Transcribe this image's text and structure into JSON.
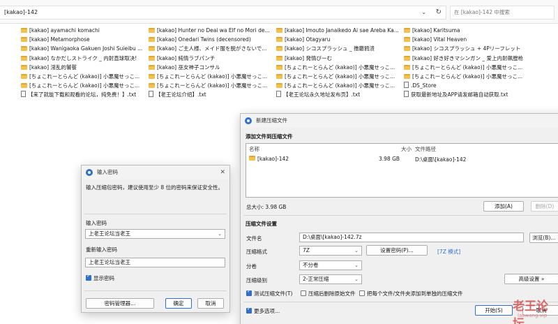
{
  "explorer": {
    "path": "[kakao]-142",
    "search_placeholder": "在 [kakao]-142 中搜索",
    "files": [
      {
        "name": "[kakao] ayamachi komachi",
        "type": "folder"
      },
      {
        "name": "[kakao] Metamorphose",
        "type": "folder"
      },
      {
        "name": "[kakao] Wanigaoka Gakuen Joshi Suieibu ...",
        "type": "folder"
      },
      {
        "name": "[kakao] なかだしストライク _ 内射直球取决!",
        "type": "folder"
      },
      {
        "name": "[kakao] 淫乱的饕餮",
        "type": "folder"
      },
      {
        "name": "[ちょこれーとらんど (kakao)] 小悪魔せっこ...",
        "type": "folder"
      },
      {
        "name": "[ちょこれーとらんど (kakao)] 小悪魔せっこ...",
        "type": "folder"
      },
      {
        "name": "【来了就能下载和观看的论坛，纯免费！】.txt",
        "type": "txt"
      },
      {
        "name": "[kakao] Hunter no Deai wa Elf no Mori de...",
        "type": "folder"
      },
      {
        "name": "[kakao] Onedari Twins (decensored)",
        "type": "folder"
      },
      {
        "name": "[kakao] ご主人様、メイド服を脱がさないで...",
        "type": "folder"
      },
      {
        "name": "[kakao] 純情ラブパンチ",
        "type": "folder"
      },
      {
        "name": "[kakao] 巫女神子コンサル",
        "type": "folder"
      },
      {
        "name": "[ちょこれーとらんど (kakao)] 小悪魔せっこ...",
        "type": "folder"
      },
      {
        "name": "[ちょこれーとらんど (kakao)] 小悪魔せっこ...",
        "type": "folder"
      },
      {
        "name": "【老王论坛介绍】.txt",
        "type": "txt"
      },
      {
        "name": "[kakao] Imouto Janaikedo Ai sae Areba Ka...",
        "type": "folder"
      },
      {
        "name": "[kakao] Otagyaru",
        "type": "folder"
      },
      {
        "name": "[kakao] シコスプラッシュ _ 撸蘑鸦溃",
        "type": "folder"
      },
      {
        "name": "[kakao] 発情びーむ",
        "type": "folder"
      },
      {
        "name": "[ちょこれーとらんど (kakao)] 小悪魔せっこ...",
        "type": "folder"
      },
      {
        "name": "[ちょこれーとらんど (kakao)] 小悪魔せっこ...",
        "type": "folder"
      },
      {
        "name": "[ちょこれーとらんど (kakao)] 小悪魔せっこ...",
        "type": "folder"
      },
      {
        "name": "【老王论坛永久地址发布页】.txt",
        "type": "txt"
      },
      {
        "name": "[kakao] Karitsuma",
        "type": "folder"
      },
      {
        "name": "[kakao] Vital Heaven",
        "type": "folder"
      },
      {
        "name": "[kakao] シコスプラッシュ + 4Pリーフレット",
        "type": "folder"
      },
      {
        "name": "[kakao] 好き好きマシンガン _ 爱上内射飙膛枪",
        "type": "folder"
      },
      {
        "name": "[ちょこれーとらんど (kakao)] 小悪魔せっこ...",
        "type": "folder"
      },
      {
        "name": "[ちょこれーとらんど (kakao)] 小悪魔せっこ...",
        "type": "folder"
      },
      {
        "name": ".DS_Store",
        "type": "txt"
      },
      {
        "name": "获取最新地址及APP请发邮箱自动获取.txt",
        "type": "txt"
      }
    ]
  },
  "password_dialog": {
    "title": "输入密码",
    "description": "输入压缩包密码，建议使用至少 8 位的密码来保证安全性。",
    "enter_label": "输入密码",
    "enter_value": "上老王论坛当老王",
    "reenter_label": "重新输入密码",
    "reenter_value": "上老王论坛当老王",
    "show_password_label": "显示密码",
    "manager_button": "密码管理器...",
    "ok_button": "确定",
    "cancel_button": "取消"
  },
  "archive_dialog": {
    "title": "新建压缩文件",
    "add_section": "添加文件到压缩文件",
    "list_headers": {
      "name": "名称",
      "size": "大小",
      "path": "文件路径"
    },
    "list_row": {
      "name": "[kakao]-142",
      "size": "3.98 GB",
      "path": "D:\\桌面\\[kakao]-142"
    },
    "total_size": "总大小: 3.98 GB",
    "add_button": "添加(A)",
    "delete_button": "删除(D)",
    "settings_section": "压缩文件设置",
    "filename_label": "文件名",
    "filename_value": "D:\\桌面\\[kakao]-142.7z",
    "browse_button": "浏览(B)...",
    "format_label": "压缩格式",
    "format_value": "7Z",
    "set_password_button": "设置密码(P)...",
    "format_mode": "[7Z 模式]",
    "volume_label": "分卷",
    "volume_value": "不分卷",
    "level_label": "压缩级别",
    "level_value": "2-正常压缩",
    "advanced_button": "高级设置 »",
    "test_label": "测试压缩文件(T)",
    "delete_after_label": "压缩后删除原始文件",
    "separate_label": "把每个文件/文件夹添加到单独的压缩文件",
    "more_options_label": "更多选项...",
    "start_button": "开始(S)",
    "cancel_button": "取消"
  },
  "watermark": {
    "text": "老王论坛",
    "sub": "laowang.vip"
  },
  "colors": {
    "accent": "#2f6fd0",
    "folder": "#f2c14e",
    "watermark": "#d63a3a"
  }
}
